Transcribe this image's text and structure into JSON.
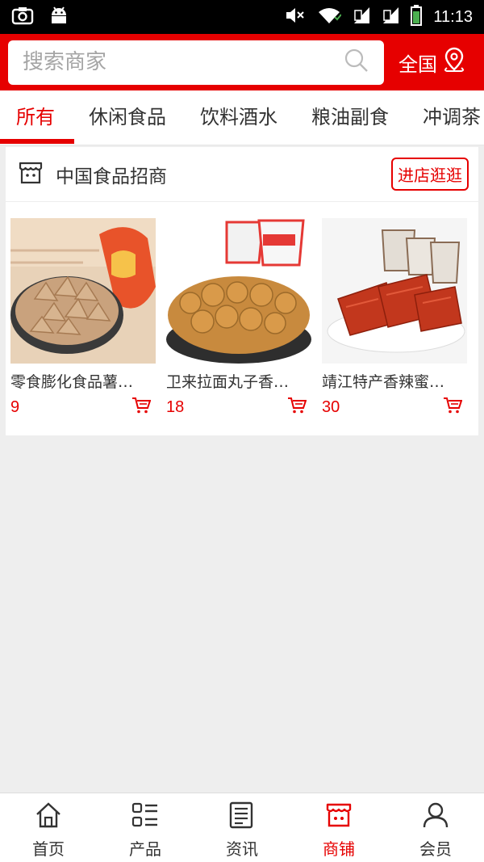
{
  "status_bar": {
    "time": "11:13"
  },
  "search": {
    "placeholder": "搜索商家"
  },
  "region": {
    "label": "全国"
  },
  "tabs": [
    {
      "label": "所有",
      "active": true
    },
    {
      "label": "休闲食品"
    },
    {
      "label": "饮料酒水"
    },
    {
      "label": "粮油副食"
    },
    {
      "label": "冲调茶"
    }
  ],
  "store": {
    "name": "中国食品招商",
    "visit_label": "进店逛逛",
    "products": [
      {
        "name": "零食膨化食品薯…",
        "price": "9",
        "image": "snack-chips"
      },
      {
        "name": "卫来拉面丸子香…",
        "price": "18",
        "image": "noodle-balls"
      },
      {
        "name": "靖江特产香辣蜜…",
        "price": "30",
        "image": "pork-jerky"
      }
    ]
  },
  "bottom_nav": [
    {
      "label": "首页",
      "icon": "home-icon"
    },
    {
      "label": "产品",
      "icon": "list-icon"
    },
    {
      "label": "资讯",
      "icon": "news-icon"
    },
    {
      "label": "商铺",
      "icon": "shop-icon",
      "active": true
    },
    {
      "label": "会员",
      "icon": "user-icon"
    }
  ],
  "colors": {
    "accent": "#e60000",
    "background": "#eeeeee"
  }
}
